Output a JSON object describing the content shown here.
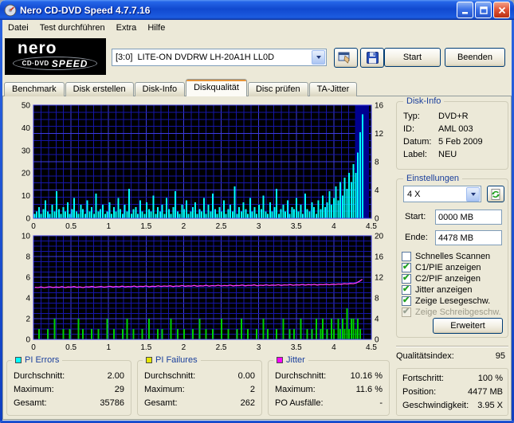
{
  "window": {
    "title": "Nero CD-DVD Speed 4.7.7.16"
  },
  "menu": {
    "items": [
      "Datei",
      "Test durchführen",
      "Extra",
      "Hilfe"
    ]
  },
  "header": {
    "logo": {
      "brand": "nero",
      "line1": "CD·DVD",
      "line2": "SPEED"
    },
    "drive_select": {
      "value": "[3:0]  LITE-ON DVDRW LH-20A1H LL0D"
    },
    "start_button": "Start",
    "quit_button": "Beenden"
  },
  "tabs": {
    "items": [
      "Benchmark",
      "Disk erstellen",
      "Disk-Info",
      "Diskqualität",
      "Disc prüfen",
      "TA-Jitter"
    ],
    "active_index": 3
  },
  "disk_info": {
    "title": "Disk-Info",
    "rows": [
      {
        "label": "Typ:",
        "value": "DVD+R"
      },
      {
        "label": "ID:",
        "value": "AML 003"
      },
      {
        "label": "Datum:",
        "value": "5 Feb 2009"
      },
      {
        "label": "Label:",
        "value": "NEU"
      }
    ]
  },
  "settings": {
    "title": "Einstellungen",
    "speed_select": "4 X",
    "start_label": "Start:",
    "start_value": "0000 MB",
    "end_label": "Ende:",
    "end_value": "4478 MB",
    "checkboxes": [
      {
        "label": "Schnelles Scannen",
        "checked": false,
        "disabled": false
      },
      {
        "label": "C1/PIE anzeigen",
        "checked": true,
        "disabled": false
      },
      {
        "label": "C2/PIF anzeigen",
        "checked": true,
        "disabled": false
      },
      {
        "label": "Jitter anzeigen",
        "checked": true,
        "disabled": false
      },
      {
        "label": "Zeige Lesegeschw.",
        "checked": true,
        "disabled": false
      },
      {
        "label": "Zeige Schreibgeschw.",
        "checked": true,
        "disabled": true
      }
    ],
    "advanced_button": "Erweitert"
  },
  "quality": {
    "label": "Qualitätsindex:",
    "value": "95"
  },
  "progress": {
    "rows": [
      {
        "label": "Fortschritt:",
        "value": "100 %"
      },
      {
        "label": "Position:",
        "value": "4477 MB"
      },
      {
        "label": "Geschwindigkeit:",
        "value": "3.95 X"
      }
    ]
  },
  "stats": {
    "panels": [
      {
        "title": "PI Errors",
        "color": "#00ffff",
        "rows": [
          {
            "label": "Durchschnitt:",
            "value": "2.00"
          },
          {
            "label": "Maximum:",
            "value": "29"
          },
          {
            "label": "Gesamt:",
            "value": "35786"
          }
        ]
      },
      {
        "title": "PI Failures",
        "color": "#e6e600",
        "rows": [
          {
            "label": "Durchschnitt:",
            "value": "0.00"
          },
          {
            "label": "Maximum:",
            "value": "2"
          },
          {
            "label": "Gesamt:",
            "value": "262"
          }
        ]
      },
      {
        "title": "Jitter",
        "color": "#ff00ff",
        "rows": [
          {
            "label": "Durchschnitt:",
            "value": "10.16 %"
          },
          {
            "label": "Maximum:",
            "value": "11.6 %"
          },
          {
            "label": "PO Ausfälle:",
            "value": "-"
          }
        ]
      }
    ]
  },
  "chart_data": [
    {
      "type": "bar",
      "title": "PI Errors vs. Position (GB)",
      "xlim": [
        0,
        4.5
      ],
      "xticks": [
        "0",
        "0.5",
        "1",
        "1.5",
        "2",
        "2.5",
        "3",
        "3.5",
        "4",
        "4.5"
      ],
      "left_axis": {
        "lim": [
          0,
          50
        ],
        "ticks": [
          50,
          40,
          30,
          20,
          10,
          0
        ]
      },
      "right_axis": {
        "lim": [
          0,
          16
        ],
        "ticks": [
          16,
          12,
          8,
          4,
          0
        ]
      },
      "grid": {
        "x_minor": 0.1,
        "x_major": 0.5,
        "y_divisions": 16,
        "y_major_every": 4
      },
      "end_block": {
        "from": 4.28,
        "to": 4.47,
        "color": "#000090"
      },
      "series": [
        {
          "name": "PI Errors",
          "style": "bars",
          "color": "#00ffff",
          "axis": "left",
          "x_start": 0.015,
          "x_step": 0.0293,
          "values": [
            2,
            3,
            5,
            2,
            4,
            8,
            3,
            2,
            6,
            3,
            12,
            4,
            2,
            5,
            3,
            7,
            2,
            4,
            9,
            3,
            2,
            6,
            4,
            2,
            8,
            3,
            5,
            2,
            11,
            3,
            4,
            6,
            2,
            3,
            7,
            2,
            5,
            3,
            9,
            4,
            2,
            6,
            3,
            13,
            2,
            4,
            5,
            2,
            8,
            3,
            2,
            7,
            4,
            3,
            10,
            2,
            5,
            3,
            6,
            2,
            9,
            4,
            2,
            5,
            12,
            3,
            2,
            6,
            4,
            8,
            2,
            3,
            5,
            7,
            2,
            4,
            3,
            9,
            2,
            6,
            3,
            11,
            4,
            2,
            5,
            3,
            8,
            2,
            4,
            6,
            3,
            14,
            2,
            5,
            3,
            7,
            4,
            2,
            9,
            3,
            5,
            2,
            6,
            4,
            10,
            3,
            2,
            7,
            3,
            5,
            13,
            2,
            4,
            6,
            3,
            8,
            2,
            5,
            4,
            9,
            3,
            6,
            2,
            11,
            4,
            3,
            7,
            5,
            2,
            8,
            4,
            10,
            5,
            7,
            12,
            6,
            9,
            14,
            8,
            16,
            10,
            18,
            13,
            20,
            16,
            24,
            20,
            29,
            38,
            46
          ]
        }
      ]
    },
    {
      "type": "bar",
      "title": "PI Failures und Jitter vs. Position (GB)",
      "xlim": [
        0,
        4.5
      ],
      "xticks": [
        "0",
        "0.5",
        "1",
        "1.5",
        "2",
        "2.5",
        "3",
        "3.5",
        "4",
        "4.5"
      ],
      "left_axis": {
        "lim": [
          0,
          10
        ],
        "ticks": [
          10,
          8,
          6,
          4,
          2,
          0
        ]
      },
      "right_axis": {
        "lim": [
          0,
          20
        ],
        "ticks": [
          20,
          16,
          12,
          8,
          4,
          0
        ]
      },
      "grid": {
        "x_minor": 0.1,
        "x_major": 0.5,
        "y_divisions": 20,
        "y_major_every": 4
      },
      "series": [
        {
          "name": "PI Failures",
          "style": "bars",
          "color": "#00d000",
          "axis": "left",
          "x_start": 0.015,
          "x_step": 0.0293,
          "values": [
            0,
            0,
            1,
            0,
            0,
            0,
            1,
            0,
            0,
            2,
            0,
            0,
            0,
            1,
            0,
            0,
            1,
            0,
            0,
            0,
            2,
            0,
            1,
            0,
            0,
            0,
            1,
            0,
            0,
            1,
            0,
            0,
            0,
            2,
            0,
            0,
            1,
            0,
            0,
            0,
            1,
            0,
            2,
            0,
            0,
            1,
            0,
            0,
            0,
            1,
            0,
            0,
            2,
            0,
            0,
            0,
            1,
            0,
            1,
            0,
            0,
            0,
            2,
            0,
            0,
            1,
            0,
            0,
            1,
            0,
            0,
            0,
            1,
            0,
            0,
            2,
            0,
            0,
            1,
            0,
            0,
            1,
            0,
            0,
            0,
            2,
            0,
            0,
            1,
            0,
            0,
            0,
            1,
            0,
            2,
            0,
            0,
            1,
            0,
            0,
            0,
            1,
            0,
            0,
            2,
            0,
            1,
            0,
            0,
            0,
            1,
            0,
            0,
            2,
            0,
            0,
            1,
            0,
            1,
            0,
            0,
            2,
            0,
            0,
            1,
            0,
            1,
            0,
            2,
            0,
            1,
            2,
            0,
            1,
            0,
            2,
            1,
            0,
            2,
            1,
            2,
            1,
            3,
            1,
            2,
            2,
            1,
            2,
            1,
            0
          ]
        },
        {
          "name": "Jitter",
          "style": "line",
          "color": "#ff3cff",
          "axis": "right",
          "x_start": 0.02,
          "x_step": 0.04,
          "values": [
            10.05,
            10.0,
            10.12,
            9.98,
            10.08,
            10.15,
            10.02,
            10.1,
            10.05,
            10.18,
            10.0,
            10.12,
            10.08,
            10.2,
            10.05,
            10.14,
            10.0,
            10.16,
            10.1,
            10.22,
            10.06,
            10.14,
            10.2,
            10.08,
            10.16,
            10.25,
            10.1,
            10.2,
            10.14,
            10.28,
            10.12,
            10.22,
            10.16,
            10.3,
            10.14,
            10.24,
            10.2,
            10.32,
            10.16,
            10.26,
            10.2,
            10.34,
            10.22,
            10.3,
            10.25,
            10.36,
            10.2,
            10.3,
            10.26,
            10.4,
            10.24,
            10.34,
            10.28,
            10.42,
            10.26,
            10.36,
            10.3,
            10.44,
            10.28,
            10.38,
            10.32,
            10.46,
            10.3,
            10.4,
            10.35,
            10.48,
            10.32,
            10.42,
            10.38,
            10.5,
            10.34,
            10.44,
            10.4,
            10.52,
            10.36,
            10.46,
            10.42,
            10.54,
            10.4,
            10.5,
            10.44,
            10.56,
            10.42,
            10.52,
            10.48,
            10.58,
            10.44,
            10.54,
            10.5,
            10.6,
            10.48,
            10.58,
            10.52,
            10.62,
            10.5,
            10.6,
            10.56,
            10.65,
            10.54,
            10.64,
            10.6,
            10.7,
            10.65,
            10.75,
            10.7,
            10.8,
            10.75,
            10.9,
            11.2,
            11.6
          ]
        }
      ]
    }
  ]
}
